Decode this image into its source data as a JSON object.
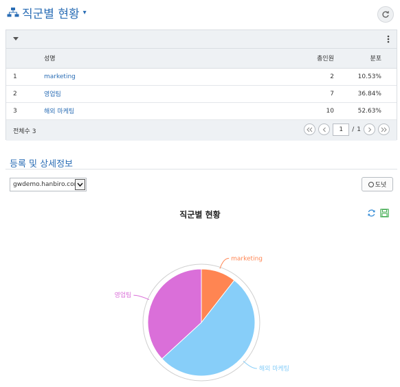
{
  "header": {
    "title": "직군별 현황",
    "caret": "▾"
  },
  "table": {
    "columns": {
      "name": "성명",
      "count": "총인원",
      "dist": "분포"
    },
    "rows": [
      {
        "no": "1",
        "name": "marketing",
        "count": "2",
        "dist": "10.53%"
      },
      {
        "no": "2",
        "name": "영업팀",
        "count": "7",
        "dist": "36.84%"
      },
      {
        "no": "3",
        "name": "해외 마케팅",
        "count": "10",
        "dist": "52.63%"
      }
    ],
    "total_label": "전체수 3",
    "pager": {
      "page": "1",
      "sep": "/",
      "pages": "1"
    }
  },
  "section": {
    "title": "등록 및 상세정보"
  },
  "domain_select": {
    "value": "gwdemo.hanbiro.com"
  },
  "donut_button": {
    "label": "도넛"
  },
  "chart_data": {
    "type": "pie",
    "title": "직군별 현황",
    "slices": [
      {
        "label": "marketing",
        "value": 2,
        "color": "#ff8552"
      },
      {
        "label": "영업팀",
        "value": 7,
        "color": "#da6fd9"
      },
      {
        "label": "해외 마케팅",
        "value": 10,
        "color": "#87cef9"
      }
    ]
  }
}
